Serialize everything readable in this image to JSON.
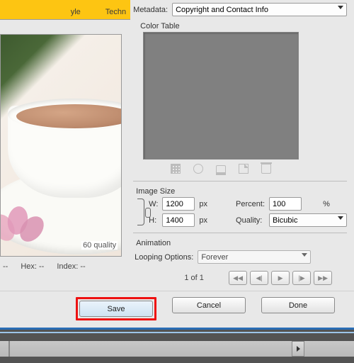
{
  "header": {
    "yellow_text_left": "yle",
    "yellow_text_right": "Techn"
  },
  "preview": {
    "quality_label": "60 quality"
  },
  "status": {
    "r": "--",
    "hex": "Hex: --",
    "index": "Index: --"
  },
  "metadata": {
    "label": "Metadata:",
    "value": "Copyright and Contact Info"
  },
  "color_table": {
    "label": "Color Table"
  },
  "image_size": {
    "section": "Image Size",
    "w_label": "W:",
    "w_value": "1200",
    "h_label": "H:",
    "h_value": "1400",
    "unit": "px",
    "percent_label": "Percent:",
    "percent_value": "100",
    "percent_unit": "%",
    "quality_label": "Quality:",
    "quality_value": "Bicubic"
  },
  "animation": {
    "section": "Animation",
    "looping_label": "Looping Options:",
    "looping_value": "Forever",
    "pager": "1 of 1"
  },
  "buttons": {
    "save": "Save",
    "cancel": "Cancel",
    "done": "Done"
  }
}
